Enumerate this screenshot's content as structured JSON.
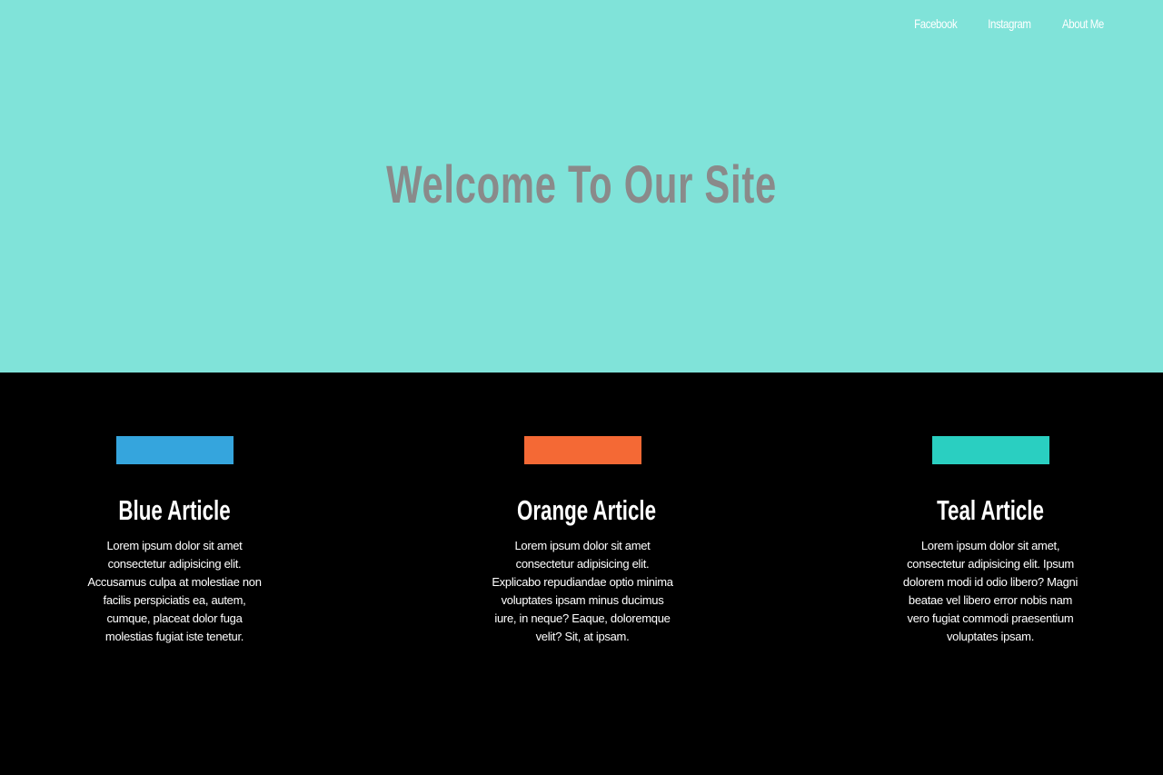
{
  "nav": {
    "items": [
      {
        "label": "Facebook"
      },
      {
        "label": "Instagram"
      },
      {
        "label": "About Me"
      }
    ]
  },
  "hero": {
    "title": "Welcome To Our Site",
    "background": "#80e3d9",
    "title_color": "#8a8a8a"
  },
  "articles": [
    {
      "title": "Blue Article",
      "color": "#35a5dd",
      "body": "Lorem ipsum dolor sit amet consectetur adipisicing elit. Accusamus culpa at molestiae non facilis perspiciatis ea, autem, cumque, placeat dolor fuga molestias fugiat iste tenetur."
    },
    {
      "title": "Orange Article",
      "color": "#f46935",
      "body": "Lorem ipsum dolor sit amet consectetur adipisicing elit. Explicabo repudiandae optio minima voluptates ipsam minus ducimus iure, in neque? Eaque, doloremque velit? Sit, at ipsam."
    },
    {
      "title": "Teal Article",
      "color": "#2acfc1",
      "body": "Lorem ipsum dolor sit amet, consectetur adipisicing elit. Ipsum dolorem modi id odio libero? Magni beatae vel libero error nobis nam vero fugiat commodi praesentium voluptates ipsam."
    }
  ]
}
